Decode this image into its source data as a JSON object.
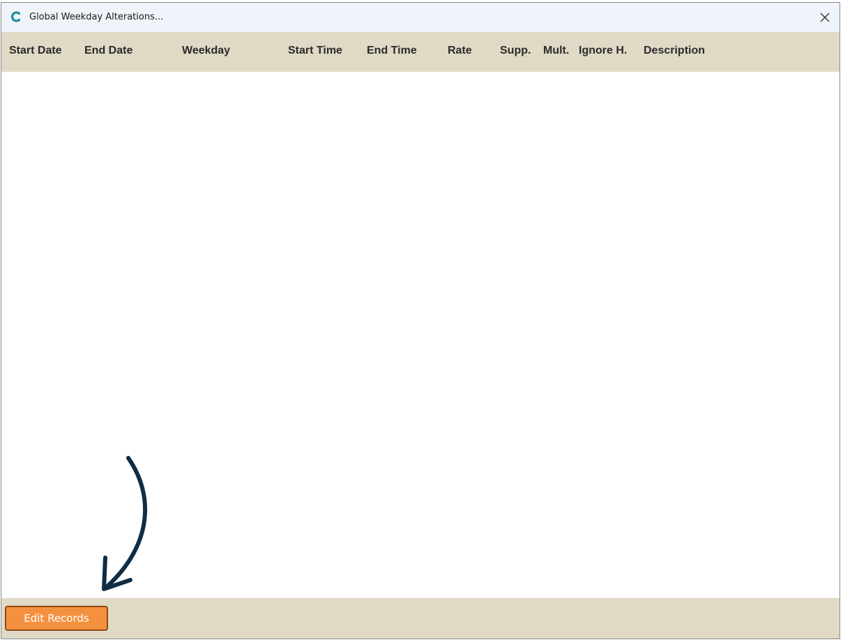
{
  "window": {
    "title": "Global Weekday Alterations..."
  },
  "table": {
    "columns": [
      "Start Date",
      "End Date",
      "Weekday",
      "Start Time",
      "End Time",
      "Rate",
      "Supp.",
      "Mult.",
      "Ignore H.",
      "Description"
    ],
    "rows": []
  },
  "footer": {
    "edit_label": "Edit Records"
  },
  "colors": {
    "header_bg": "#e0d9c5",
    "button_bg": "#f4913f",
    "arrow": "#0f2d44",
    "app_icon": "#1a8fa0"
  },
  "icons": {
    "app": "app-logo-icon",
    "close": "close-icon",
    "arrow": "curved-arrow-icon"
  }
}
